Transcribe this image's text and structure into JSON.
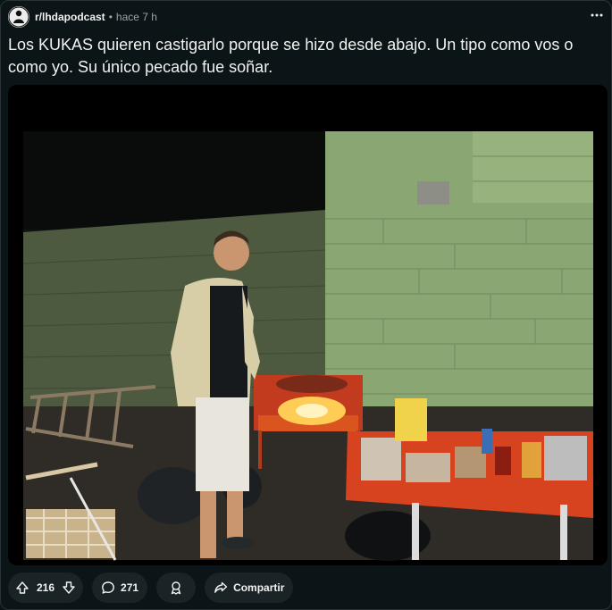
{
  "post": {
    "subreddit": "r/lhdapodcast",
    "separator": "•",
    "time": "hace 7 h",
    "title": "Los KUKAS quieren castigarlo porque se hizo desde abajo. Un tipo como vos o como yo. Su único pecado fue soñar."
  },
  "media": {
    "icon": "photo-of-man-at-barbecue-grill"
  },
  "actions": {
    "upvotes": "216",
    "comments": "271",
    "award_icon": "award-icon",
    "share_label": "Compartir"
  },
  "colors": {
    "background": "#0b1416",
    "pill": "#1a2326",
    "text": "#f2f2f2",
    "muted": "#9aa3a6"
  }
}
